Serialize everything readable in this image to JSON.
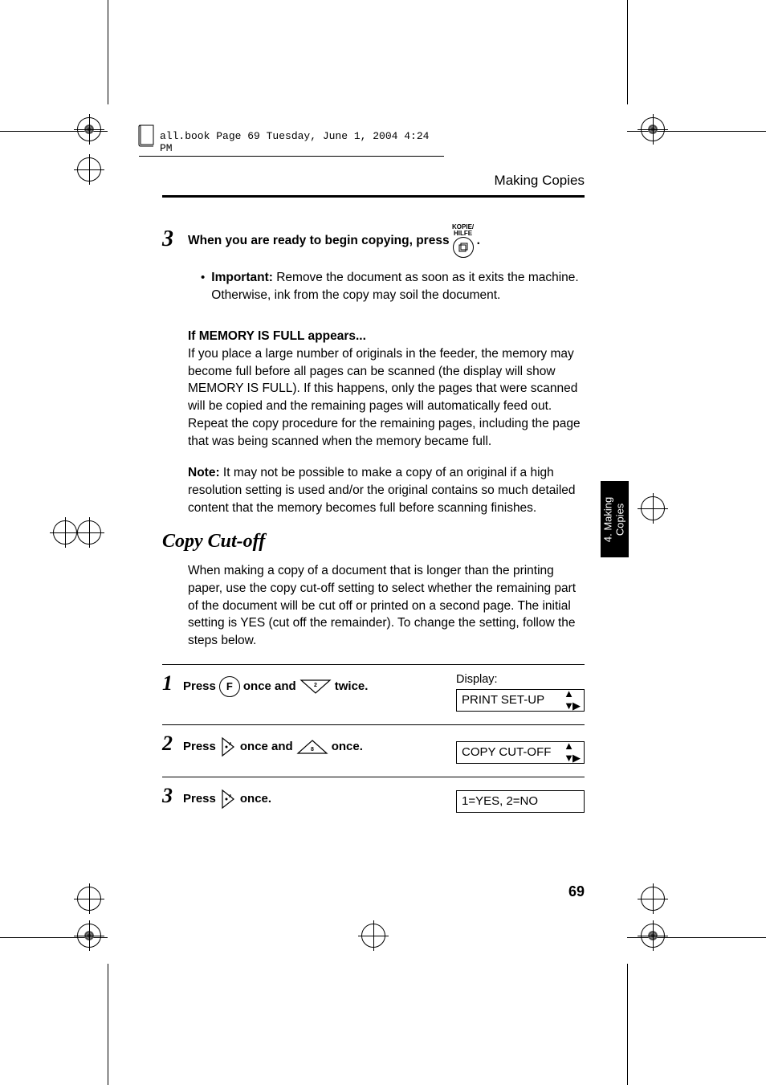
{
  "header_strip": "all.book  Page 69  Tuesday, June 1, 2004  4:24 PM",
  "running_head": "Making Copies",
  "step3": {
    "number": "3",
    "text_before_btn": "When you are ready to begin copying, press ",
    "btn_top_label": "KOPIE/\nHILFE",
    "text_after_btn": " ."
  },
  "bullet": {
    "strong": "Important:",
    "rest": " Remove the document as soon as it exits the machine. Otherwise, ink from the copy may soil the document."
  },
  "mem_heading": "If MEMORY IS FULL appears...",
  "mem_body": "If you place a large number of originals in the feeder, the memory may become full before all pages can be scanned (the display will show MEMORY IS FULL). If this happens, only the pages that were scanned will be copied and the remaining pages will automatically feed out. Repeat the copy procedure for the remaining pages, including the page that was being scanned when the memory became full.",
  "note_strong": "Note:",
  "note_body": " It may not be possible to make a copy of an original if a high resolution setting is used and/or the original contains so much detailed content that the memory becomes full before scanning finishes.",
  "section_title": "Copy Cut-off",
  "section_body": "When making a copy of a document that is longer than the printing paper, use the copy cut-off setting to select whether the remaining part of the document will be cut off or printed on a second page. The initial setting is YES (cut off the remainder). To change the setting, follow the steps below.",
  "side_tab": "4. Making\nCopies",
  "table": {
    "display_label": "Display:",
    "rows": [
      {
        "num": "1",
        "parts": [
          "Press ",
          "F",
          " once and ",
          "down",
          " twice."
        ],
        "lcd": "PRINT SET-UP"
      },
      {
        "num": "2",
        "parts": [
          "Press ",
          "play",
          " once and ",
          "up",
          " once."
        ],
        "lcd": "COPY CUT-OFF"
      },
      {
        "num": "3",
        "parts": [
          "Press ",
          "play",
          " once."
        ],
        "lcd": "1=YES, 2=NO"
      }
    ]
  },
  "page_number": "69"
}
